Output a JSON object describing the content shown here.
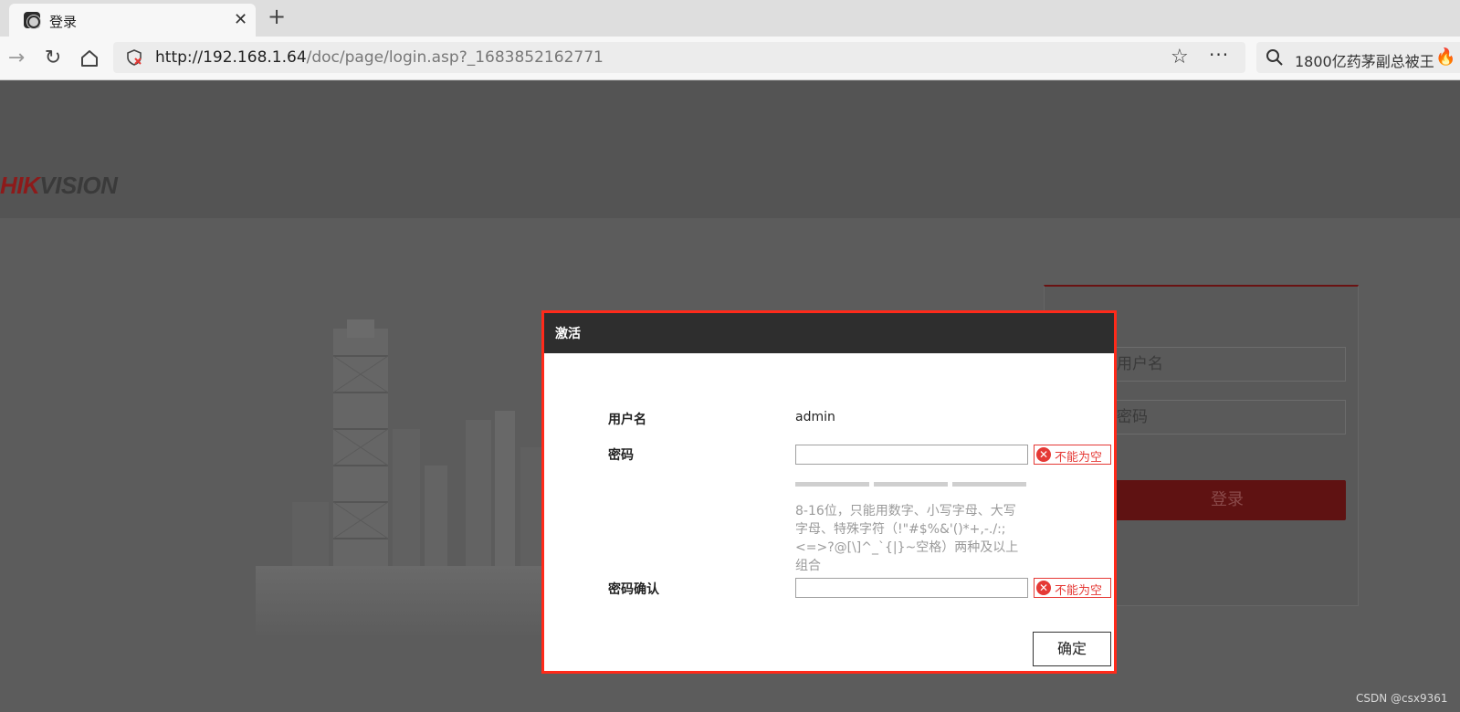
{
  "browser": {
    "tab": {
      "title": "登录"
    },
    "url": {
      "host": "http://192.168.1.64",
      "path": "/doc/page/login.asp?_1683852162771"
    },
    "search": {
      "text": "1800亿药茅副总被王"
    }
  },
  "page": {
    "logo": {
      "hik": "HIK",
      "vision": "VISION"
    },
    "login": {
      "username_placeholder": "用户名",
      "password_placeholder": "密码",
      "login_button": "登录"
    }
  },
  "dialog": {
    "title": "激活",
    "username_label": "用户名",
    "username_value": "admin",
    "password_label": "密码",
    "password_error": "不能为空",
    "password_hint": "8-16位，只能用数字、小写字母、大写字母、特殊字符（!\"#$%&'()*+,-./:;<=>?@[\\]^_`{|}~空格）两种及以上组合",
    "confirm_label": "密码确认",
    "confirm_error": "不能为空",
    "ok_button": "确定"
  },
  "watermark": "CSDN @csx9361",
  "colors": {
    "accent_red": "#e53935",
    "dialog_border": "#ff2a1a",
    "dialog_header": "#2e2e2e"
  }
}
